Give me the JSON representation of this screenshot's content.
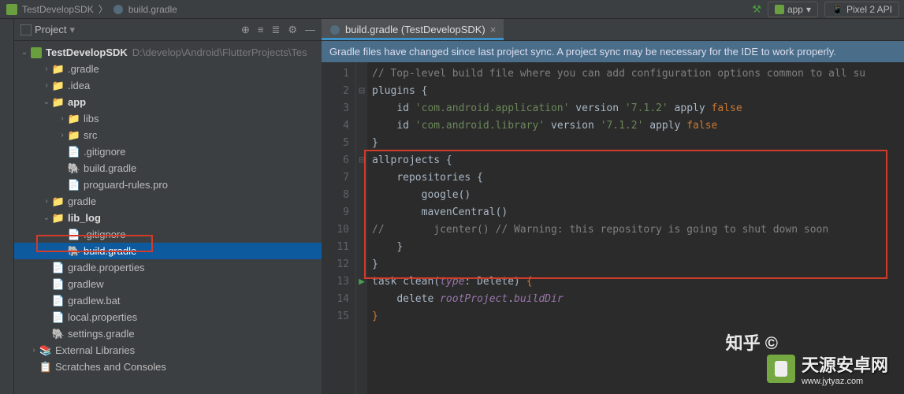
{
  "breadcrumb": {
    "seg1": "TestDevelopSDK",
    "seg2": "build.gradle"
  },
  "topbar": {
    "app": "app",
    "device": "Pixel 2 API"
  },
  "sidebar": {
    "title": "Project",
    "root": "TestDevelopSDK",
    "rootPath": "D:\\develop\\Android\\FlutterProjects\\Tes",
    "items": {
      "gradle": ".gradle",
      "idea": ".idea",
      "app": "app",
      "libs": "libs",
      "src": "src",
      "gitignore1": ".gitignore",
      "buildgradle1": "build.gradle",
      "proguard": "proguard-rules.pro",
      "gradledir": "gradle",
      "liblog": "lib_log",
      "gitignore2": ".gitignore",
      "buildgradle2": "build.gradle",
      "gradleprops": "gradle.properties",
      "gradlew": "gradlew",
      "gradlewbat": "gradlew.bat",
      "localprops": "local.properties",
      "settings": "settings.gradle",
      "extlib": "External Libraries",
      "scratches": "Scratches and Consoles"
    }
  },
  "tab": {
    "label": "build.gradle (TestDevelopSDK)"
  },
  "banner": {
    "text": "Gradle files have changed since last project sync. A project sync may be necessary for the IDE to work properly."
  },
  "gutter": [
    "1",
    "2",
    "3",
    "4",
    "5",
    "6",
    "7",
    "8",
    "9",
    "10",
    "11",
    "12",
    "13",
    "14",
    "15"
  ],
  "code": {
    "l1": "// Top-level build file where you can add configuration options common to all su",
    "l2_kw": "plugins",
    "l3_id": "id",
    "l3_str": "'com.android.application'",
    "l3_ver": "version",
    "l3_verstr": "'7.1.2'",
    "l3_apply": "apply",
    "l3_false": "false",
    "l4_id": "id",
    "l4_str": "'com.android.library'",
    "l4_ver": "version",
    "l4_verstr": "'7.1.2'",
    "l4_apply": "apply",
    "l4_false": "false",
    "l6": "allprojects",
    "l7": "repositories",
    "l8": "google()",
    "l9": "mavenCentral()",
    "l10": "//        jcenter() // Warning: this repository is going to shut down soon",
    "l13_task": "task",
    "l13_clean": "clean",
    "l13_type": "type",
    "l13_del": "Delete",
    "l14_del": "delete",
    "l14_root": "rootProject",
    "l14_bd": "buildDir"
  },
  "watermark": {
    "main": "天源安卓网",
    "sub": "www.jytyaz.com",
    "zhihu": "知乎 ©"
  },
  "chart_data": {
    "type": "table",
    "note": "code editor content is in code.* keys"
  }
}
